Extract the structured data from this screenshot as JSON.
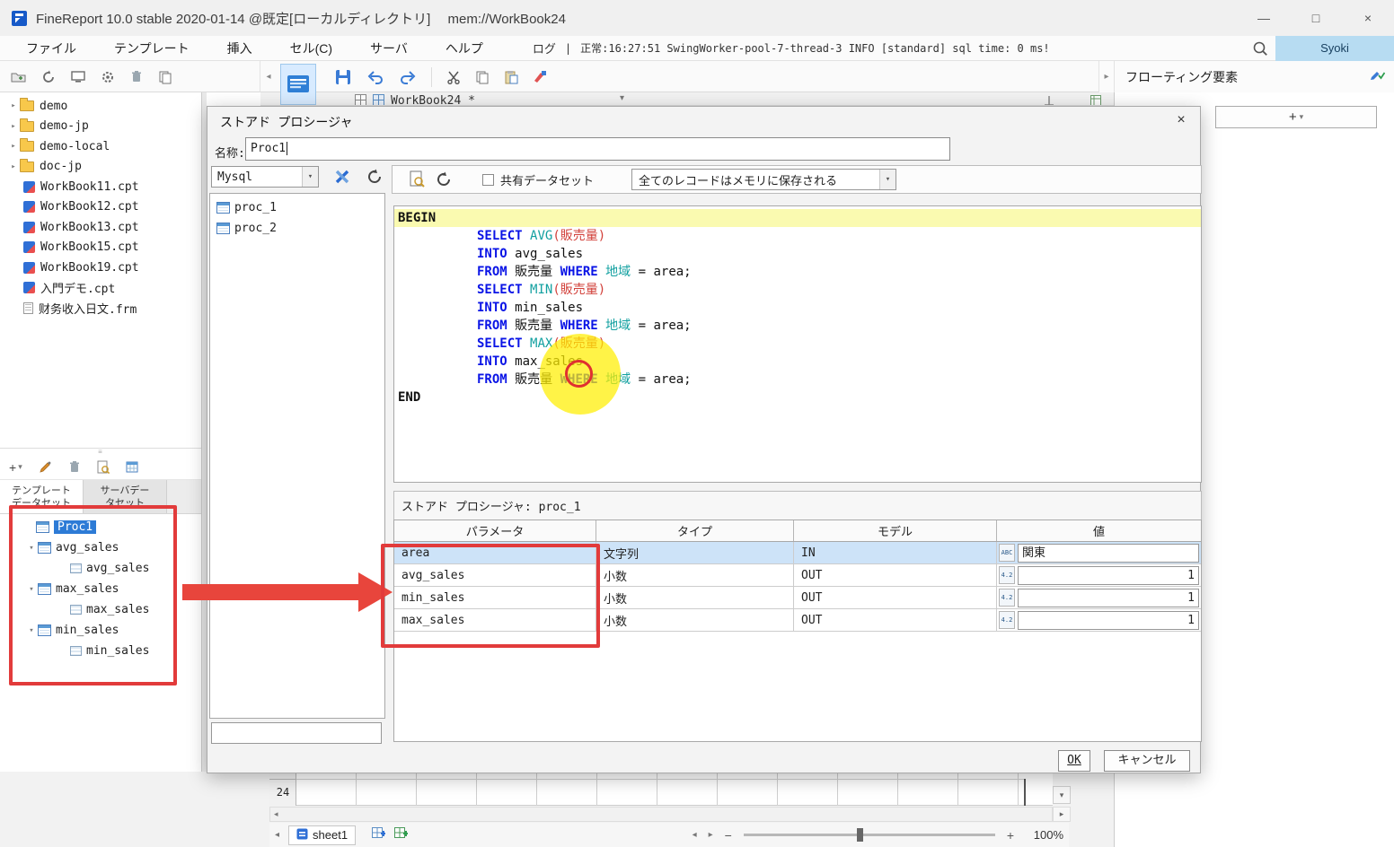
{
  "colors": {
    "accent_blue": "#2d7bd6",
    "annotation_red": "#e23b3b",
    "sql_highlight_yellow": "#fafab0",
    "selection_blue": "#cde3f8",
    "user_badge_bg": "#b7dcf2"
  },
  "icons": {
    "minimize": "—",
    "maximize": "□",
    "close": "×",
    "chevron_right": "▸",
    "chevron_down": "▾",
    "left_arrow": "◂",
    "right_arrow": "▸",
    "plus": "+",
    "minus": "−",
    "splitter_grip": "≡"
  },
  "titlebar": {
    "title": "FineReport 10.0 stable 2020-01-14 @既定[ローカルディレクトリ]　 mem://WorkBook24"
  },
  "menubar": {
    "items": [
      "ファイル",
      "テンプレート",
      "挿入",
      "セル(C)",
      "サーバ",
      "ヘルプ"
    ],
    "log_label": "ログ",
    "divider": "|",
    "status_text": "正常:16:27:51 SwingWorker-pool-7-thread-3 INFO [standard] sql time: 0 ms!",
    "user_button": "Syoki"
  },
  "tabstrip": {
    "tab_label": "WorkBook24 *"
  },
  "right_panel": {
    "title": "フローティング要素",
    "add_label": "+"
  },
  "sidebar": {
    "file_tree": [
      {
        "label": "demo",
        "type": "folder"
      },
      {
        "label": "demo-jp",
        "type": "folder"
      },
      {
        "label": "demo-local",
        "type": "folder"
      },
      {
        "label": "doc-jp",
        "type": "folder"
      },
      {
        "label": "WorkBook11.cpt",
        "type": "cpt"
      },
      {
        "label": "WorkBook12.cpt",
        "type": "cpt"
      },
      {
        "label": "WorkBook13.cpt",
        "type": "cpt"
      },
      {
        "label": "WorkBook15.cpt",
        "type": "cpt"
      },
      {
        "label": "WorkBook19.cpt",
        "type": "cpt"
      },
      {
        "label": "入門デモ.cpt",
        "type": "cpt"
      },
      {
        "label": "财务收入日文.frm",
        "type": "frm"
      }
    ],
    "dataset_tabs": [
      {
        "line1": "テンプレート",
        "line2": "データセット",
        "active": true
      },
      {
        "line1": "サーバデー",
        "line2": "タセット",
        "active": false
      }
    ],
    "dataset_tree": [
      {
        "label": "Proc1",
        "level": 0,
        "selected": true,
        "icon": "ds"
      },
      {
        "label": "avg_sales",
        "level": 1,
        "expanded": true,
        "icon": "ds"
      },
      {
        "label": "avg_sales",
        "level": 2,
        "icon": "field"
      },
      {
        "label": "max_sales",
        "level": 1,
        "expanded": true,
        "icon": "ds"
      },
      {
        "label": "max_sales",
        "level": 2,
        "icon": "field"
      },
      {
        "label": "min_sales",
        "level": 1,
        "expanded": true,
        "icon": "ds"
      },
      {
        "label": "min_sales",
        "level": 2,
        "icon": "field"
      }
    ]
  },
  "dialog": {
    "title": "ストアド プロシージャ",
    "name_label": "名称:",
    "name_value": "Proc1",
    "db_type": "Mysql",
    "proc_list": [
      "proc_1",
      "proc_2"
    ],
    "share_dataset_label": "共有データセット",
    "memory_option": "全てのレコードはメモリに保存される",
    "sql_lines": [
      {
        "hl": true,
        "ind": 0,
        "toks": [
          [
            "kw2",
            "BEGIN"
          ]
        ]
      },
      {
        "ind": 1,
        "toks": [
          [
            "kw",
            "SELECT "
          ],
          [
            "fn",
            "AVG"
          ],
          [
            "red",
            "(販売量)"
          ]
        ]
      },
      {
        "ind": 1,
        "toks": [
          [
            "kw",
            "INTO "
          ],
          [
            "pl",
            "avg_sales"
          ]
        ]
      },
      {
        "ind": 1,
        "toks": [
          [
            "kw",
            "FROM "
          ],
          [
            "pl",
            "販売量 "
          ],
          [
            "kw",
            "WHERE "
          ],
          [
            "fn",
            "地域"
          ],
          [
            "pl",
            " = area;"
          ]
        ]
      },
      {
        "ind": 1,
        "toks": [
          [
            "kw",
            "SELECT "
          ],
          [
            "fn",
            "MIN"
          ],
          [
            "red",
            "(販売量)"
          ]
        ]
      },
      {
        "ind": 1,
        "toks": [
          [
            "kw",
            "INTO "
          ],
          [
            "pl",
            "min_sales"
          ]
        ]
      },
      {
        "ind": 1,
        "toks": [
          [
            "kw",
            "FROM "
          ],
          [
            "pl",
            "販売量 "
          ],
          [
            "kw",
            "WHERE "
          ],
          [
            "fn",
            "地域"
          ],
          [
            "pl",
            " = area;"
          ]
        ]
      },
      {
        "ind": 1,
        "toks": [
          [
            "kw",
            "SELECT "
          ],
          [
            "fn",
            "MAX"
          ],
          [
            "red",
            "(販売量)"
          ]
        ]
      },
      {
        "ind": 1,
        "toks": [
          [
            "kw",
            "INTO "
          ],
          [
            "pl",
            "max_sales"
          ]
        ]
      },
      {
        "ind": 1,
        "toks": [
          [
            "kw",
            "FROM "
          ],
          [
            "pl",
            "販売量 "
          ],
          [
            "kw",
            "WHERE "
          ],
          [
            "fn",
            "地域"
          ],
          [
            "pl",
            " = area;"
          ]
        ]
      },
      {
        "ind": 0,
        "toks": [
          [
            "kw2",
            "END"
          ]
        ]
      }
    ],
    "table_caption": "ストアド プロシージャ: proc_1",
    "param_table": {
      "headers": [
        "パラメータ",
        "タイプ",
        "モデル",
        "値"
      ],
      "rows": [
        {
          "param": "area",
          "type": "文字列",
          "model": "IN",
          "badge": "ABC",
          "value": "関東",
          "selected": true,
          "align": "left"
        },
        {
          "param": "avg_sales",
          "type": "小数",
          "model": "OUT",
          "badge": "4.2",
          "value": "1",
          "selected": false,
          "align": "right"
        },
        {
          "param": "min_sales",
          "type": "小数",
          "model": "OUT",
          "badge": "4.2",
          "value": "1",
          "selected": false,
          "align": "right"
        },
        {
          "param": "max_sales",
          "type": "小数",
          "model": "OUT",
          "badge": "4.2",
          "value": "1",
          "selected": false,
          "align": "right"
        }
      ]
    },
    "ok_label": "OK",
    "cancel_label": "キャンセル"
  },
  "statusbar": {
    "row_number": "24",
    "sheet_tab": "sheet1",
    "zoom_level": "100%"
  }
}
